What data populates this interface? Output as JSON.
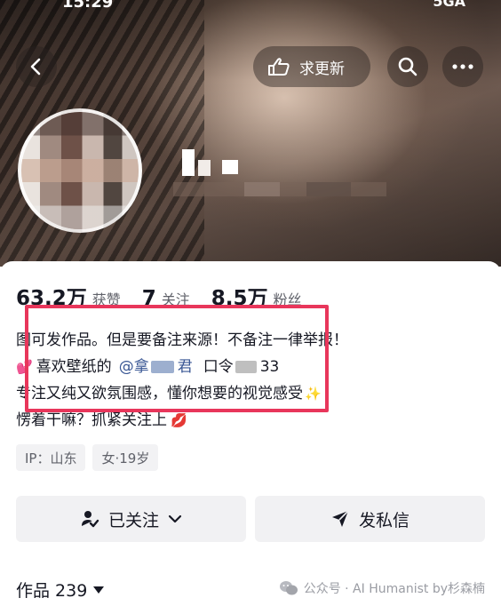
{
  "status_bar": {
    "time": "15:29",
    "network": "5GA"
  },
  "header": {
    "back_icon": "chevron-left-icon",
    "update_label": "求更新",
    "search_icon": "search-icon",
    "more_icon": "more-dots-icon"
  },
  "stats": [
    {
      "value": "63.2万",
      "label": "获赞"
    },
    {
      "value": "7",
      "label": "关注"
    },
    {
      "value": "8.5万",
      "label": "粉丝"
    }
  ],
  "bio": {
    "line1": "图可发作品。但是要备注来源！不备注一律举报！",
    "line2_prefix": "喜欢壁纸的",
    "line2_mention_start": "@拿",
    "line2_mention_end": "君",
    "line2_code_label": "口令",
    "line2_code_end": "33",
    "line3": "专注又纯又欲氛围感，懂你想要的视觉感受",
    "line4": "愣着干嘛？抓紧关注上"
  },
  "tags": [
    "IP：山东",
    "女·19岁"
  ],
  "actions": {
    "follow_label": "已关注",
    "message_label": "发私信"
  },
  "works": {
    "label": "作品 239"
  },
  "watermark": {
    "text": "公众号 · AI Humanist by杉森楠"
  },
  "colors": {
    "highlight": "#e8365b",
    "mention": "#3a5794"
  }
}
